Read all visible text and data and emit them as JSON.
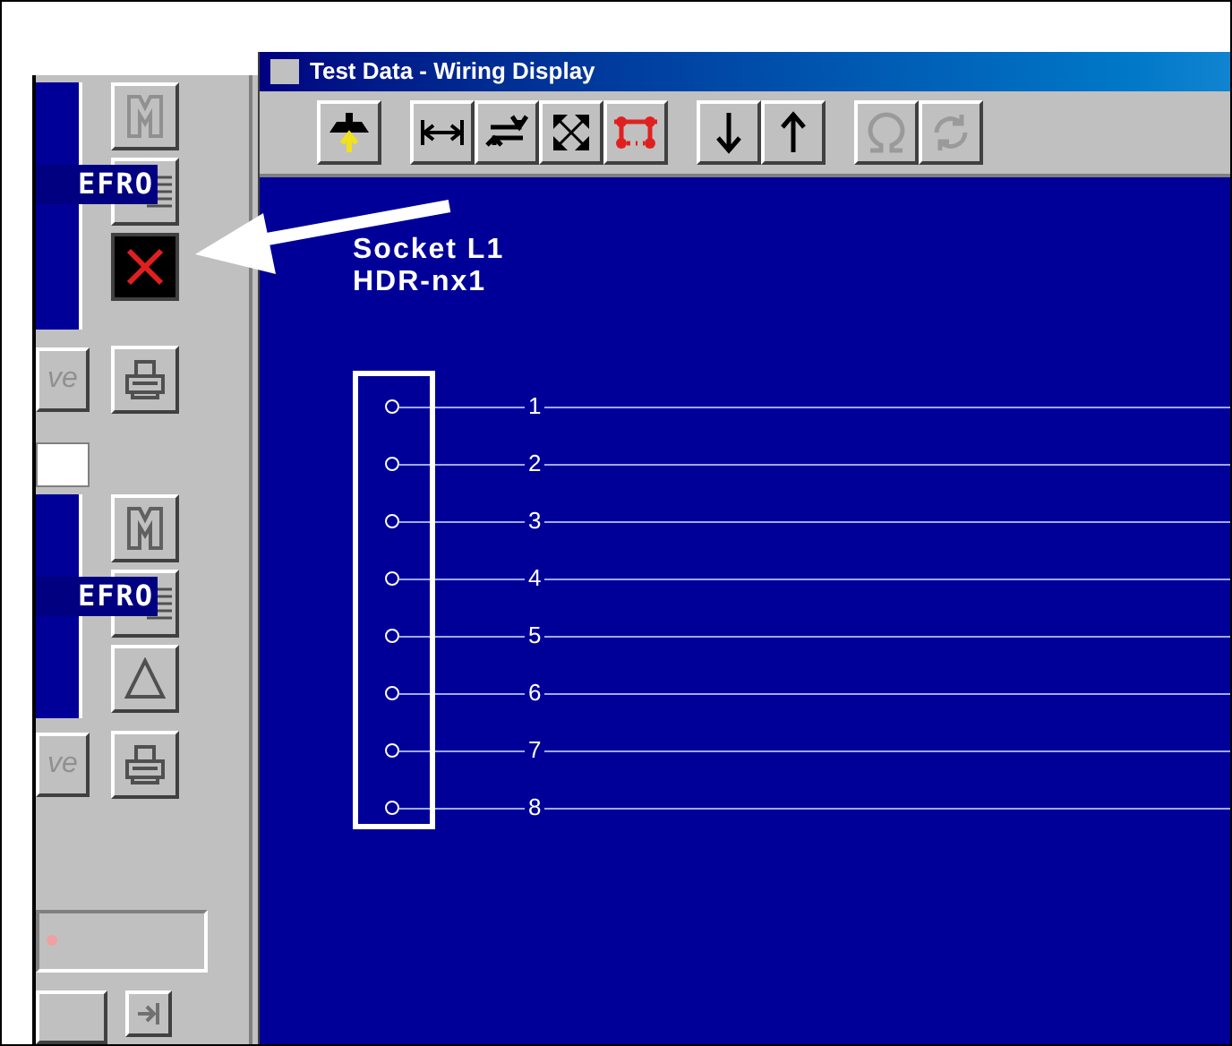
{
  "left_panel": {
    "groups": [
      {
        "tag": "EFRO",
        "side_button": "ve",
        "buttons": [
          {
            "kind": "merge",
            "disabled": true
          },
          {
            "kind": "blank",
            "disabled": false
          },
          {
            "kind": "delete",
            "disabled": false
          }
        ],
        "extra_button": {
          "kind": "print",
          "disabled": false
        }
      },
      {
        "tag": "EFRO",
        "side_button": "ve",
        "buttons": [
          {
            "kind": "merge",
            "disabled": false
          },
          {
            "kind": "blank",
            "disabled": false
          },
          {
            "kind": "triangle",
            "disabled": false
          }
        ],
        "extra_button": {
          "kind": "print",
          "disabled": false
        }
      }
    ]
  },
  "window": {
    "title": "Test Data - Wiring Display",
    "toolbar": [
      {
        "kind": "connector",
        "disabled": false
      },
      {
        "kind": "stretch",
        "disabled": false
      },
      {
        "kind": "swap",
        "disabled": false
      },
      {
        "kind": "expand",
        "disabled": false
      },
      {
        "kind": "pins",
        "disabled": false
      },
      {
        "kind": "down",
        "disabled": false
      },
      {
        "kind": "up",
        "disabled": false
      },
      {
        "kind": "omega",
        "disabled": true
      },
      {
        "kind": "cycle",
        "disabled": true
      }
    ],
    "socket": {
      "name": "Socket L1",
      "part": "HDR-nx1",
      "pins": [
        {
          "number": "1"
        },
        {
          "number": "2"
        },
        {
          "number": "3"
        },
        {
          "number": "4"
        },
        {
          "number": "5"
        },
        {
          "number": "6"
        },
        {
          "number": "7"
        },
        {
          "number": "8"
        }
      ]
    }
  }
}
